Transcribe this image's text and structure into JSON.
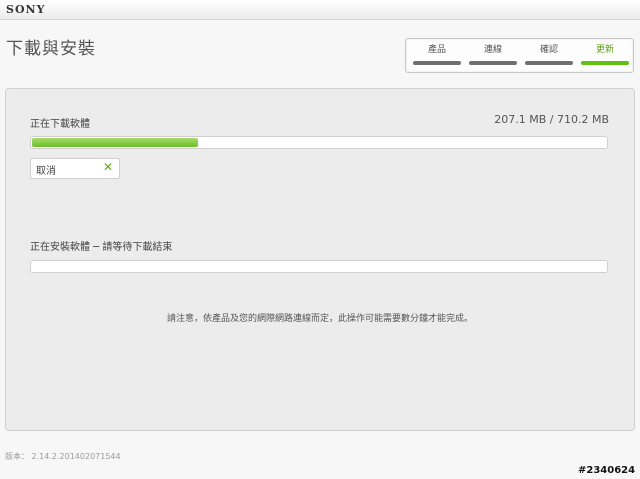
{
  "brand": "SONY",
  "page_title": "下載與安裝",
  "steps": [
    {
      "label": "產品",
      "active": false
    },
    {
      "label": "連線",
      "active": false
    },
    {
      "label": "確認",
      "active": false
    },
    {
      "label": "更新",
      "active": true
    }
  ],
  "download": {
    "label": "正在下載軟體",
    "size_text": "207.1 MB / 710.2 MB",
    "progress_fraction": 0.292,
    "cancel_label": "取消",
    "cancel_icon": "close-icon",
    "accent_color": "#62c012"
  },
  "install": {
    "label": "正在安裝軟體 ─ 請等待下載結束",
    "progress_fraction": 0
  },
  "note": "請注意，依產品及您的網際網路連線而定，此操作可能需要數分鐘才能完成。",
  "version": "版本： 2.14.2.201402071544",
  "watermark": "#2340624"
}
